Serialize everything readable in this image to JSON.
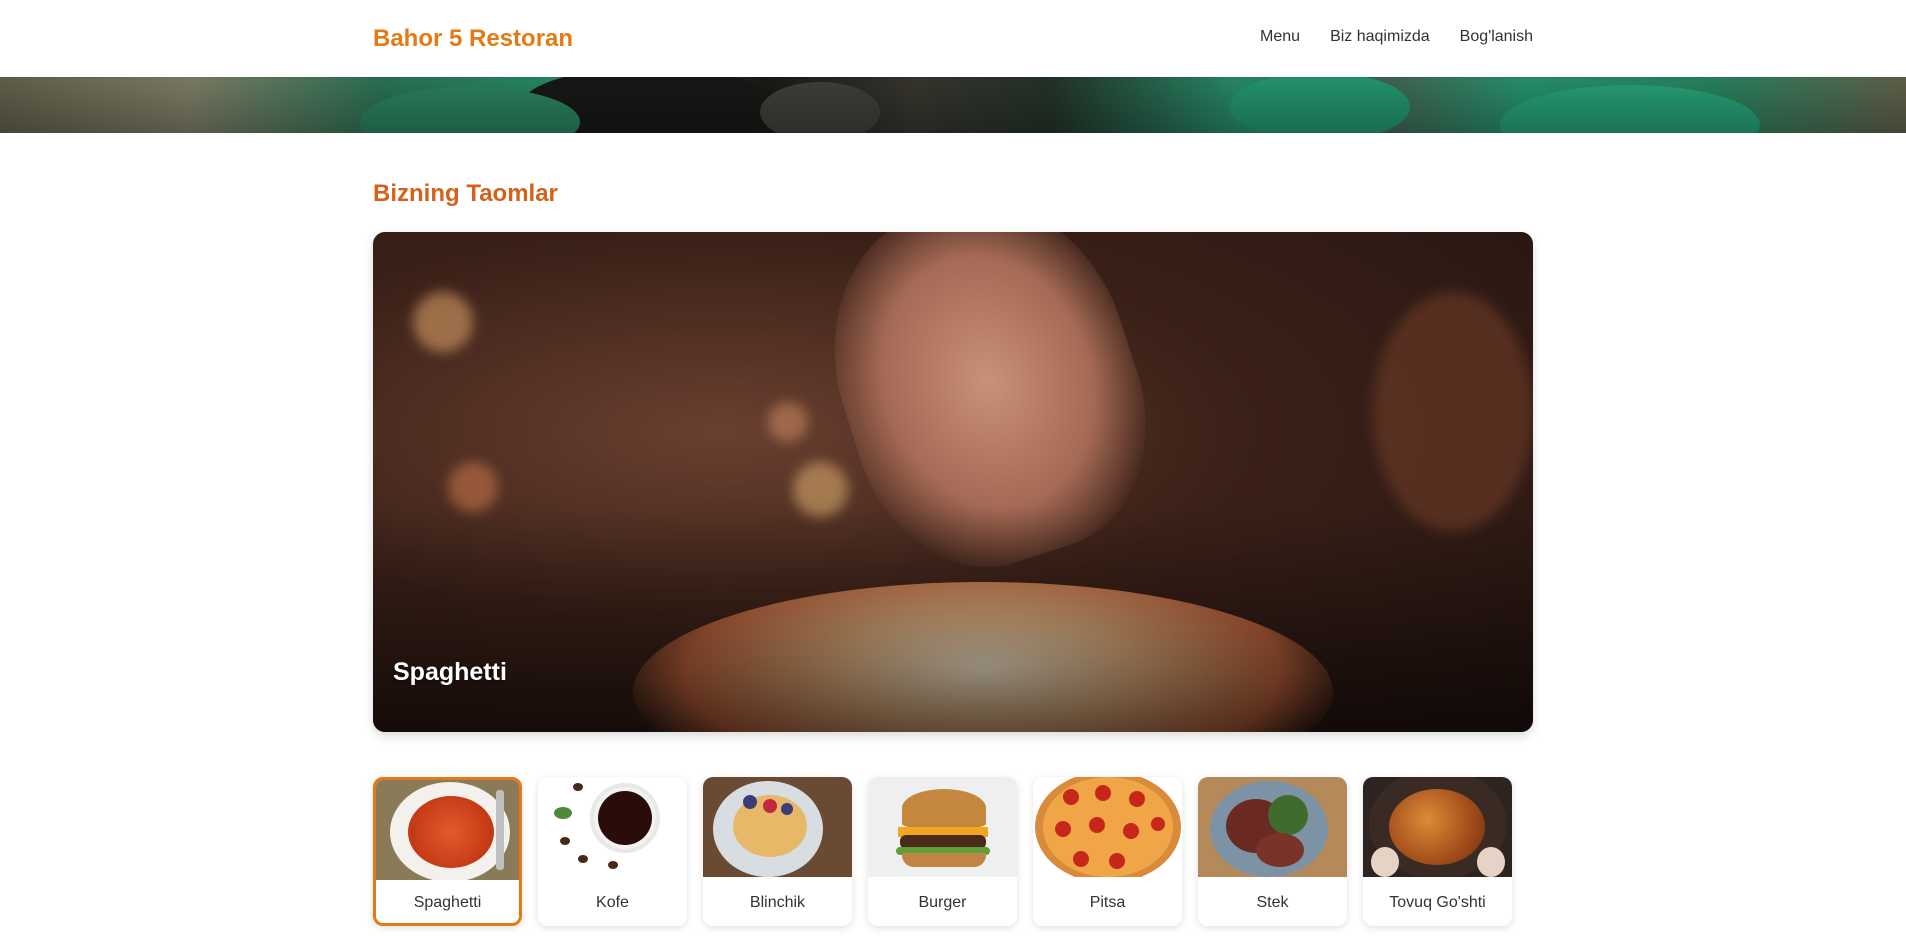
{
  "navbar": {
    "brand": "Bahor 5 Restoran",
    "links": [
      "Menu",
      "Biz haqimizda",
      "Bog'lanish"
    ]
  },
  "section": {
    "title": "Bizning Taomlar"
  },
  "featured": {
    "caption": "Spaghetti"
  },
  "dishes": [
    {
      "label": "Spaghetti",
      "active": true
    },
    {
      "label": "Kofe",
      "active": false
    },
    {
      "label": "Blinchik",
      "active": false
    },
    {
      "label": "Burger",
      "active": false
    },
    {
      "label": "Pitsa",
      "active": false
    },
    {
      "label": "Stek",
      "active": false
    },
    {
      "label": "Tovuq Go'shti",
      "active": false
    }
  ],
  "colors": {
    "accent": "#e47a16",
    "title": "#d5611c"
  }
}
